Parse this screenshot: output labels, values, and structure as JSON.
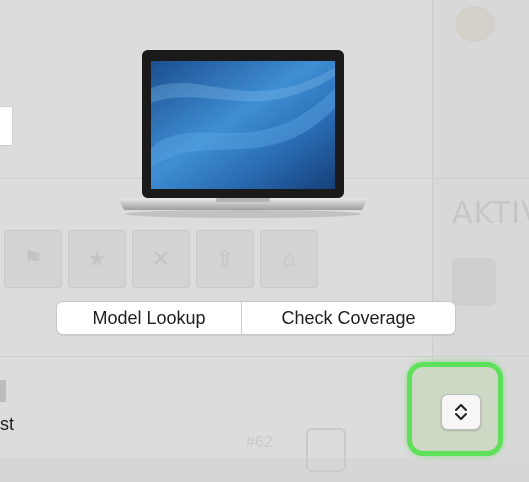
{
  "device": {
    "image_label": "MacBook Pro laptop"
  },
  "actions": {
    "model_lookup_label": "Model Lookup",
    "check_coverage_label": "Check Coverage"
  },
  "background": {
    "left_partial_text": "st",
    "right_partial_text": "AKTIV",
    "bottom_partial_number": "#62"
  },
  "stepper": {
    "icon": "chevron-up-down-icon"
  },
  "colors": {
    "highlight": "#5fe05a",
    "screen_blue": "#2d6fb6"
  }
}
